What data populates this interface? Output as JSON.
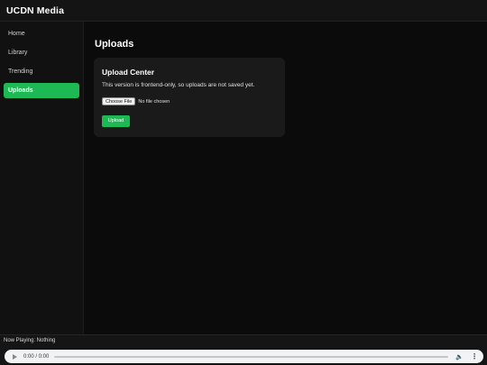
{
  "app": {
    "title": "UCDN Media"
  },
  "sidebar": {
    "items": [
      {
        "label": "Home",
        "active": false
      },
      {
        "label": "Library",
        "active": false
      },
      {
        "label": "Trending",
        "active": false
      },
      {
        "label": "Uploads",
        "active": true
      }
    ]
  },
  "main": {
    "title": "Uploads",
    "card": {
      "title": "Upload Center",
      "text": "This version is frontend-only, so uploads are not saved yet.",
      "file_button_label": "Choose File",
      "file_status": "No file chosen",
      "upload_label": "Upload"
    }
  },
  "player": {
    "now_playing": "Now Playing: Nothing",
    "time": "0:00 / 0:00",
    "icons": {
      "play": "play-icon",
      "volume": "volume-icon",
      "more": "more-options-icon"
    }
  },
  "colors": {
    "accent": "#1db954",
    "background": "#0b0b0b",
    "card": "#1a1a1a"
  }
}
